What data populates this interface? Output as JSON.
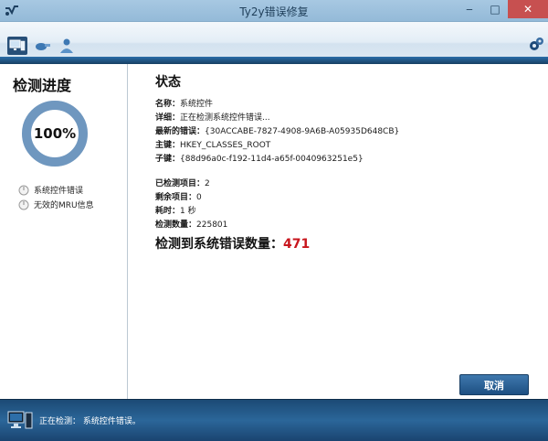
{
  "window": {
    "title": "Ty2y错误修复",
    "minimize_label": "‒",
    "maximize_label": "□",
    "close_label": "✕"
  },
  "toolbar": {
    "buttons": [
      {
        "icon": "scan-monitor-icon",
        "active": true
      },
      {
        "icon": "tools-icon",
        "active": false
      },
      {
        "icon": "user-icon",
        "active": false
      }
    ],
    "corner_icon": "settings-gear-icon"
  },
  "left": {
    "title": "检测进度",
    "progress_percent": 100,
    "progress_label": "100%",
    "items": [
      {
        "label": "系统控件错误",
        "icon": "pending-circle-icon"
      },
      {
        "label": "无效的MRU信息",
        "icon": "pending-circle-icon"
      }
    ]
  },
  "status": {
    "title": "状态",
    "name_label": "名称：",
    "name_value": "系统控件",
    "detail_label": "详细：",
    "detail_value": "正在检测系统控件错误...",
    "latest_label": "最新的错误：",
    "latest_value": "{30ACCABE-7827-4908-9A6B-A05935D648CB}",
    "main_key_label": "主键：",
    "main_key_value": "HKEY_CLASSES_ROOT",
    "sub_key_label": "子键：",
    "sub_key_value": "{88d96a0c-f192-11d4-a65f-0040963251e5}",
    "checked_items_label": "已检测项目：",
    "checked_items_value": "2",
    "remaining_label": "剩余项目：",
    "remaining_value": "0",
    "elapsed_label": "耗时：",
    "elapsed_value": "1 秒",
    "check_count_label": "检测数量：",
    "check_count_value": "225801",
    "errors_label": "检测到系统错误数量：",
    "errors_value": "471"
  },
  "actions": {
    "cancel_label": "取消"
  },
  "statusbar": {
    "text": "正在检测：  系统控件错误。"
  },
  "colors": {
    "accent": "#2b6ea9",
    "progress_ring": "#6f97bf",
    "error_count": "#c8161d"
  }
}
